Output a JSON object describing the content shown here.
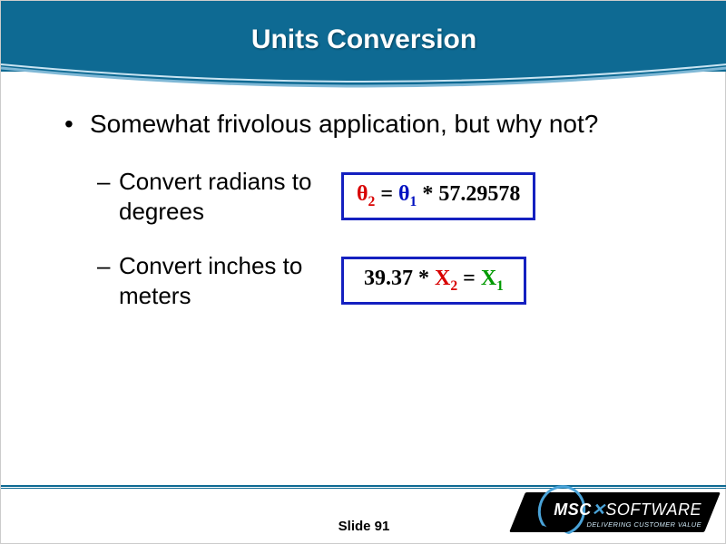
{
  "title": "Units Conversion",
  "bullet_main": "Somewhat frivolous application, but why not?",
  "sub": [
    {
      "text": "Convert radians to degrees"
    },
    {
      "text": "Convert inches to meters"
    }
  ],
  "formula1": {
    "theta2": "θ",
    "sub2": "2",
    "eq": " = ",
    "theta1": "θ",
    "sub1": "1",
    "tail": " * 57.29578"
  },
  "formula2": {
    "lead": "39.37 * ",
    "x2": "X",
    "s2": "2",
    "eq2": " = ",
    "x1": "X",
    "s1": "1"
  },
  "footer": {
    "slide_label": "Slide 91"
  },
  "logo": {
    "brand_a": "MSC",
    "brand_b": "SOFTWARE",
    "tagline": "DELIVERING CUSTOMER VALUE"
  }
}
